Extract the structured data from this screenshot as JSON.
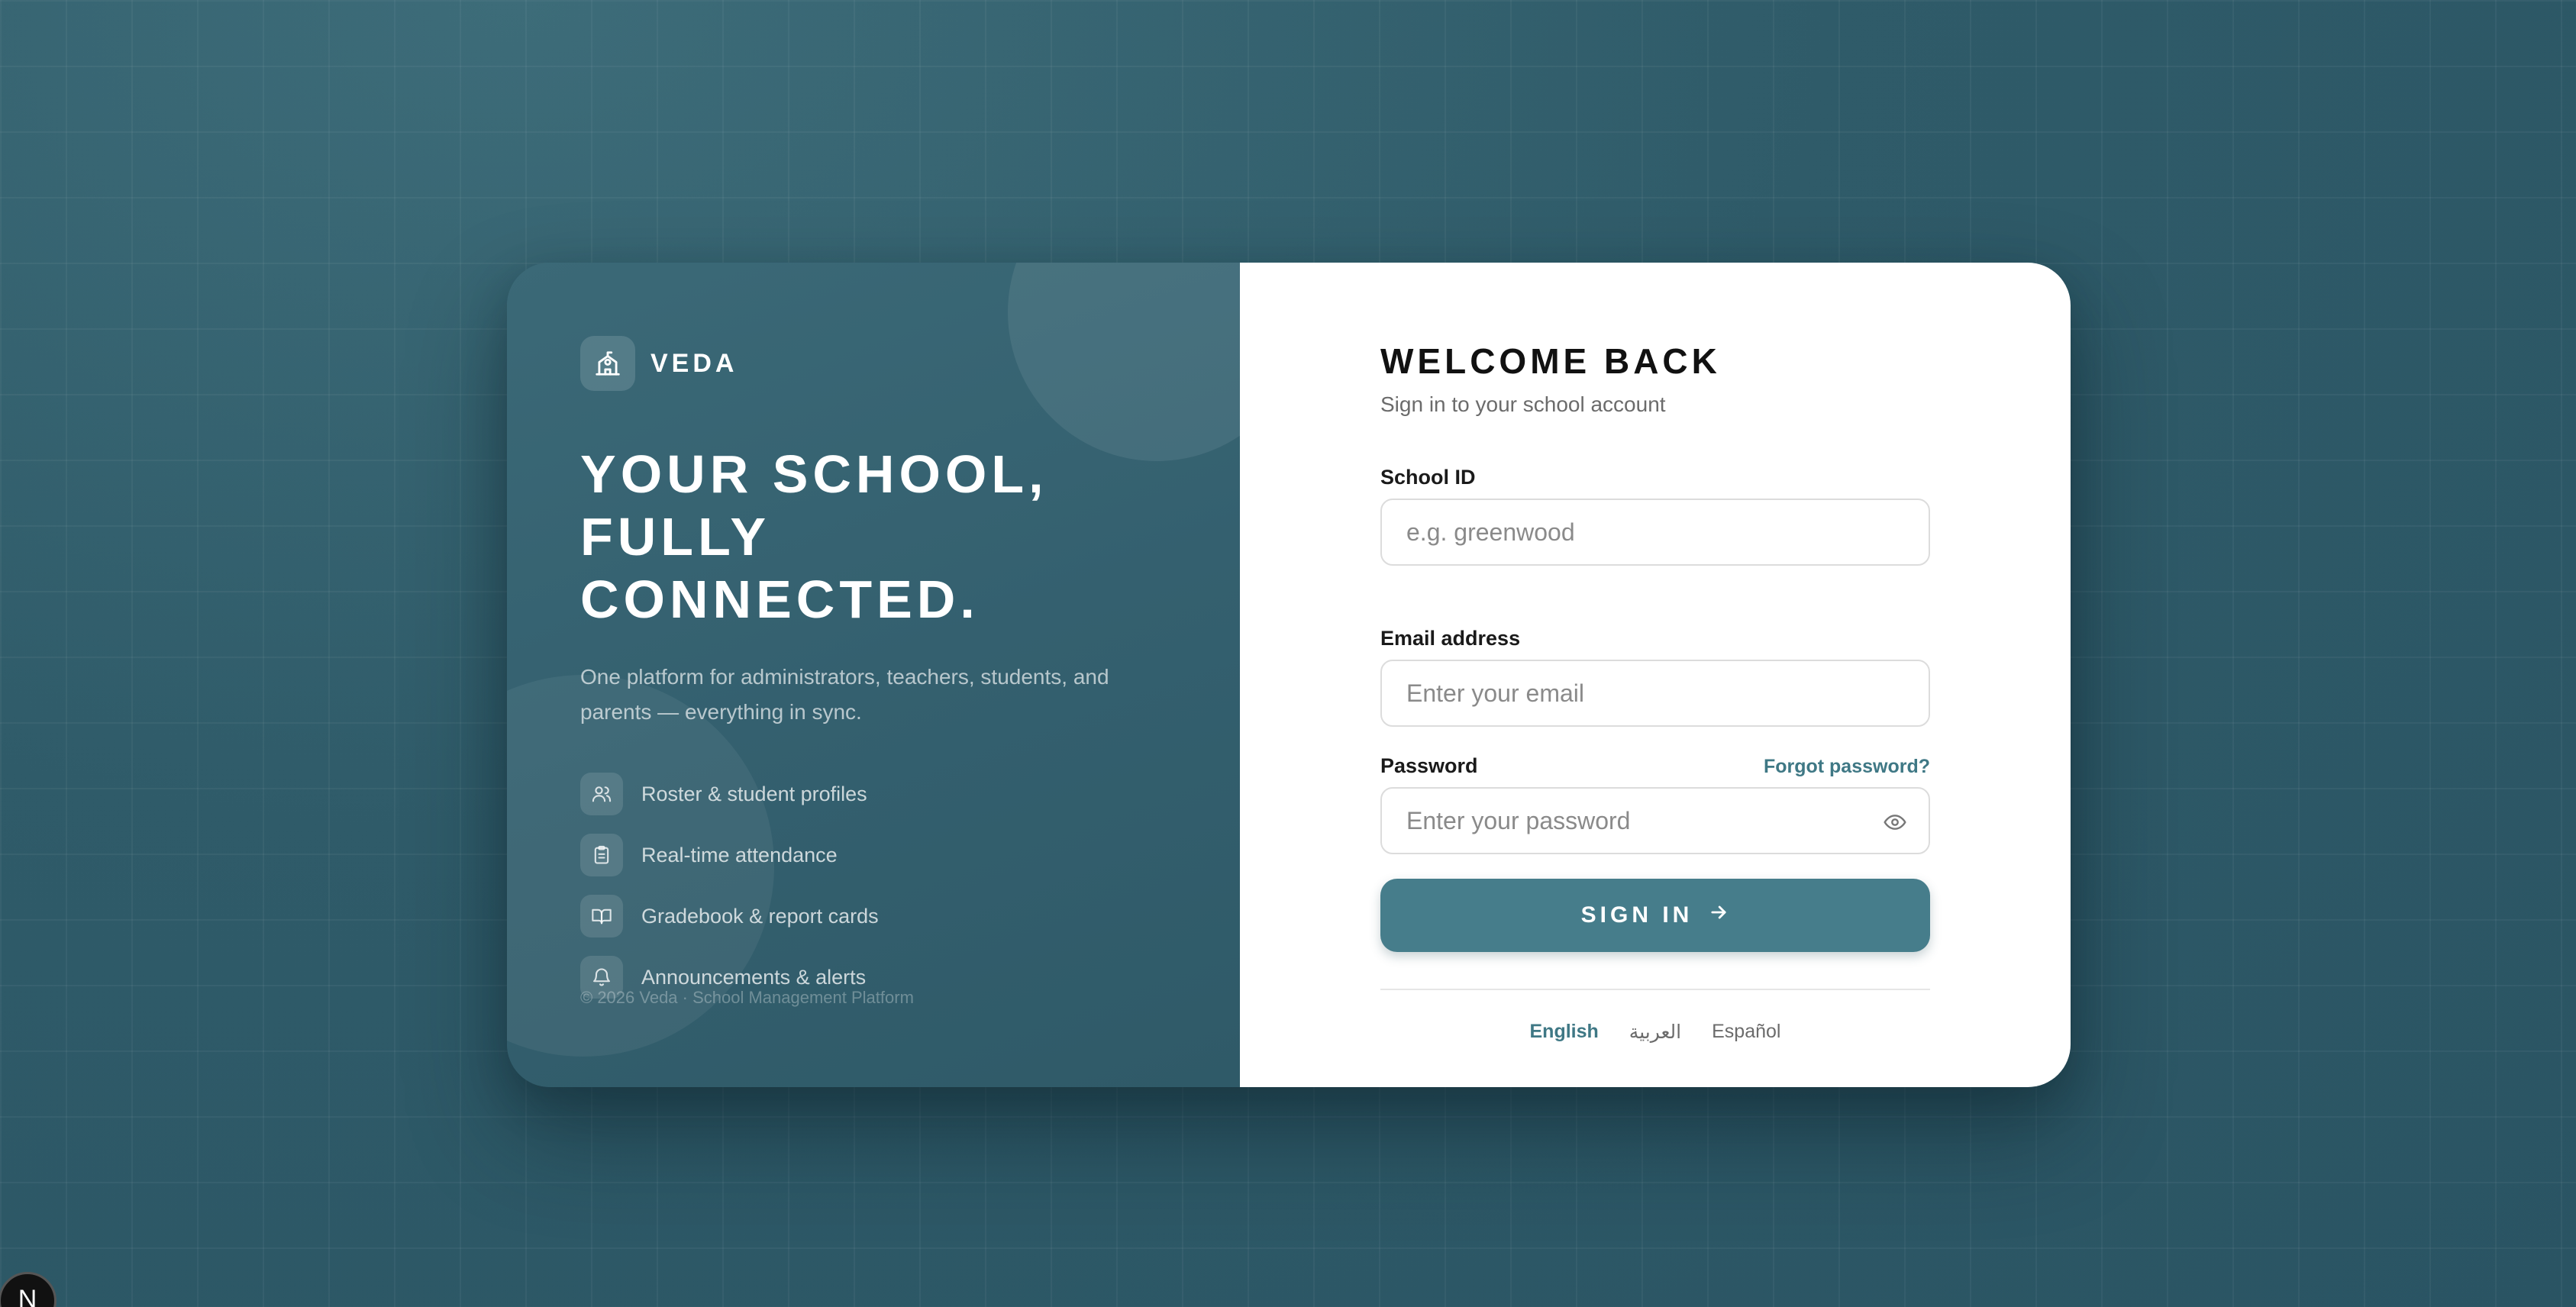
{
  "colors": {
    "background": "#2f5b69",
    "panel": "#34606f",
    "accent": "#467d8b",
    "link": "#3f7885"
  },
  "brand": {
    "name": "VEDA",
    "icon": "school-building-icon"
  },
  "hero": {
    "headline_line1": "YOUR SCHOOL,",
    "headline_line2": "FULLY CONNECTED.",
    "tagline": "One platform for administrators, teachers, students, and parents — everything in sync."
  },
  "features": [
    {
      "label": "Roster & student profiles",
      "icon": "users-icon"
    },
    {
      "label": "Real-time attendance",
      "icon": "clipboard-icon"
    },
    {
      "label": "Gradebook & report cards",
      "icon": "book-open-icon"
    },
    {
      "label": "Announcements & alerts",
      "icon": "bell-icon"
    }
  ],
  "footer": {
    "copyright": "© 2026 Veda · School Management Platform"
  },
  "login": {
    "title": "WELCOME BACK",
    "subtitle": "Sign in to your school account",
    "school_id": {
      "label": "School ID",
      "placeholder": "e.g. greenwood",
      "value": ""
    },
    "email": {
      "label": "Email address",
      "placeholder": "Enter your email",
      "value": ""
    },
    "password": {
      "label": "Password",
      "placeholder": "Enter your password",
      "value": "",
      "forgot_label": "Forgot password?"
    },
    "submit_label": "SIGN IN"
  },
  "languages": [
    {
      "label": "English",
      "active": true
    },
    {
      "label": "العربية",
      "active": false
    },
    {
      "label": "Español",
      "active": false
    }
  ],
  "dev_badge": {
    "label": "N"
  }
}
